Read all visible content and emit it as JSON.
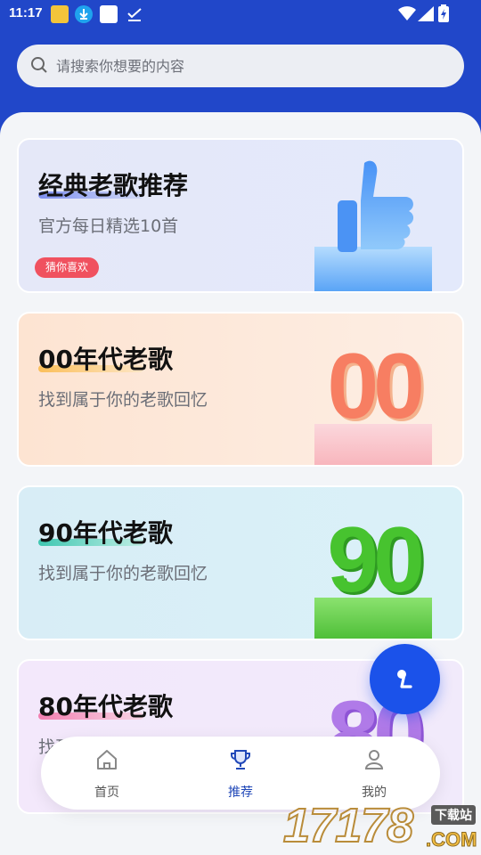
{
  "status_bar": {
    "time": "11:17"
  },
  "search": {
    "placeholder": "请搜索你想要的内容",
    "value": ""
  },
  "cards": [
    {
      "title": "经典老歌推荐",
      "subtitle": "官方每日精选10首",
      "tag": "猜你喜欢",
      "illustration": "thumbs-up"
    },
    {
      "title": "00年代老歌",
      "subtitle": "找到属于你的老歌回忆",
      "illustration_text": "00"
    },
    {
      "title": "90年代老歌",
      "subtitle": "找到属于你的老歌回忆",
      "illustration_text": "90"
    },
    {
      "title": "80年代老歌",
      "subtitle": "找到属于你的老歌回忆",
      "illustration_text": "80"
    }
  ],
  "tabs": [
    {
      "label": "首页",
      "icon": "home-icon",
      "active": false
    },
    {
      "label": "推荐",
      "icon": "trophy-icon",
      "active": true
    },
    {
      "label": "我的",
      "icon": "user-icon",
      "active": false
    }
  ],
  "fab": {
    "icon": "music-note-icon"
  },
  "watermark": {
    "number": "17178",
    "badge": "下载站",
    "domain": ".COM"
  },
  "colors": {
    "header_bg": "#2147c9",
    "accent": "#1b52ea",
    "tag_bg": "#f0515f",
    "active_tab": "#2148b8"
  }
}
